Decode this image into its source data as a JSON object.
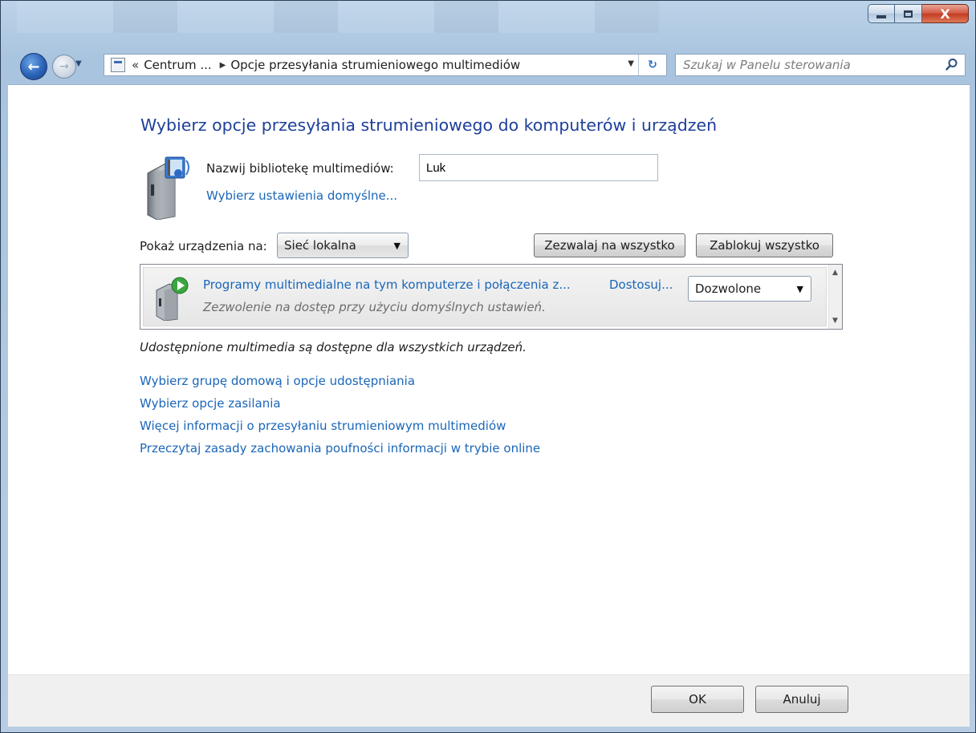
{
  "window": {
    "minimize_label": "_",
    "maximize_label": "□",
    "close_label": "X"
  },
  "navbar": {
    "back_label": "←",
    "forward_label": "→",
    "address_chevron": "«",
    "address_segments": [
      "Centrum ...",
      "Opcje przesyłania strumieniowego multimediów"
    ],
    "address_separator": "▶",
    "dropdown_arrow": "▼",
    "refresh_label": "↻",
    "search_placeholder": "Szukaj w Panelu sterowania"
  },
  "main": {
    "heading": "Wybierz opcje przesyłania strumieniowego do komputerów i urządzeń",
    "library_label": "Nazwij bibliotekę multimediów:",
    "library_value": "Luk",
    "default_settings_link": "Wybierz ustawienia domyślne...",
    "show_devices_label": "Pokaż urządzenia na:",
    "show_devices_value": "Sieć lokalna",
    "allow_all_label": "Zezwalaj na wszystko",
    "block_all_label": "Zablokuj wszystko",
    "device_list": {
      "items": [
        {
          "title": "Programy multimedialne na tym komputerze i połączenia z...",
          "customize": "Dostosuj...",
          "status": "Dozwolone",
          "subtitle": "Zezwolenie na dostęp przy użyciu domyślnych ustawień."
        }
      ]
    },
    "shared_note": "Udostępnione multimedia są dostępne dla wszystkich urządzeń.",
    "links": [
      "Wybierz grupę domową i opcje udostępniania",
      "Wybierz opcje zasilania",
      "Więcej informacji o przesyłaniu strumieniowym multimediów",
      "Przeczytaj zasady zachowania poufności informacji w trybie online"
    ]
  },
  "footer": {
    "ok_label": "OK",
    "cancel_label": "Anuluj"
  },
  "colors": {
    "heading": "#1e3f9a",
    "link": "#1a66b8",
    "close_button": "#c43a22"
  }
}
